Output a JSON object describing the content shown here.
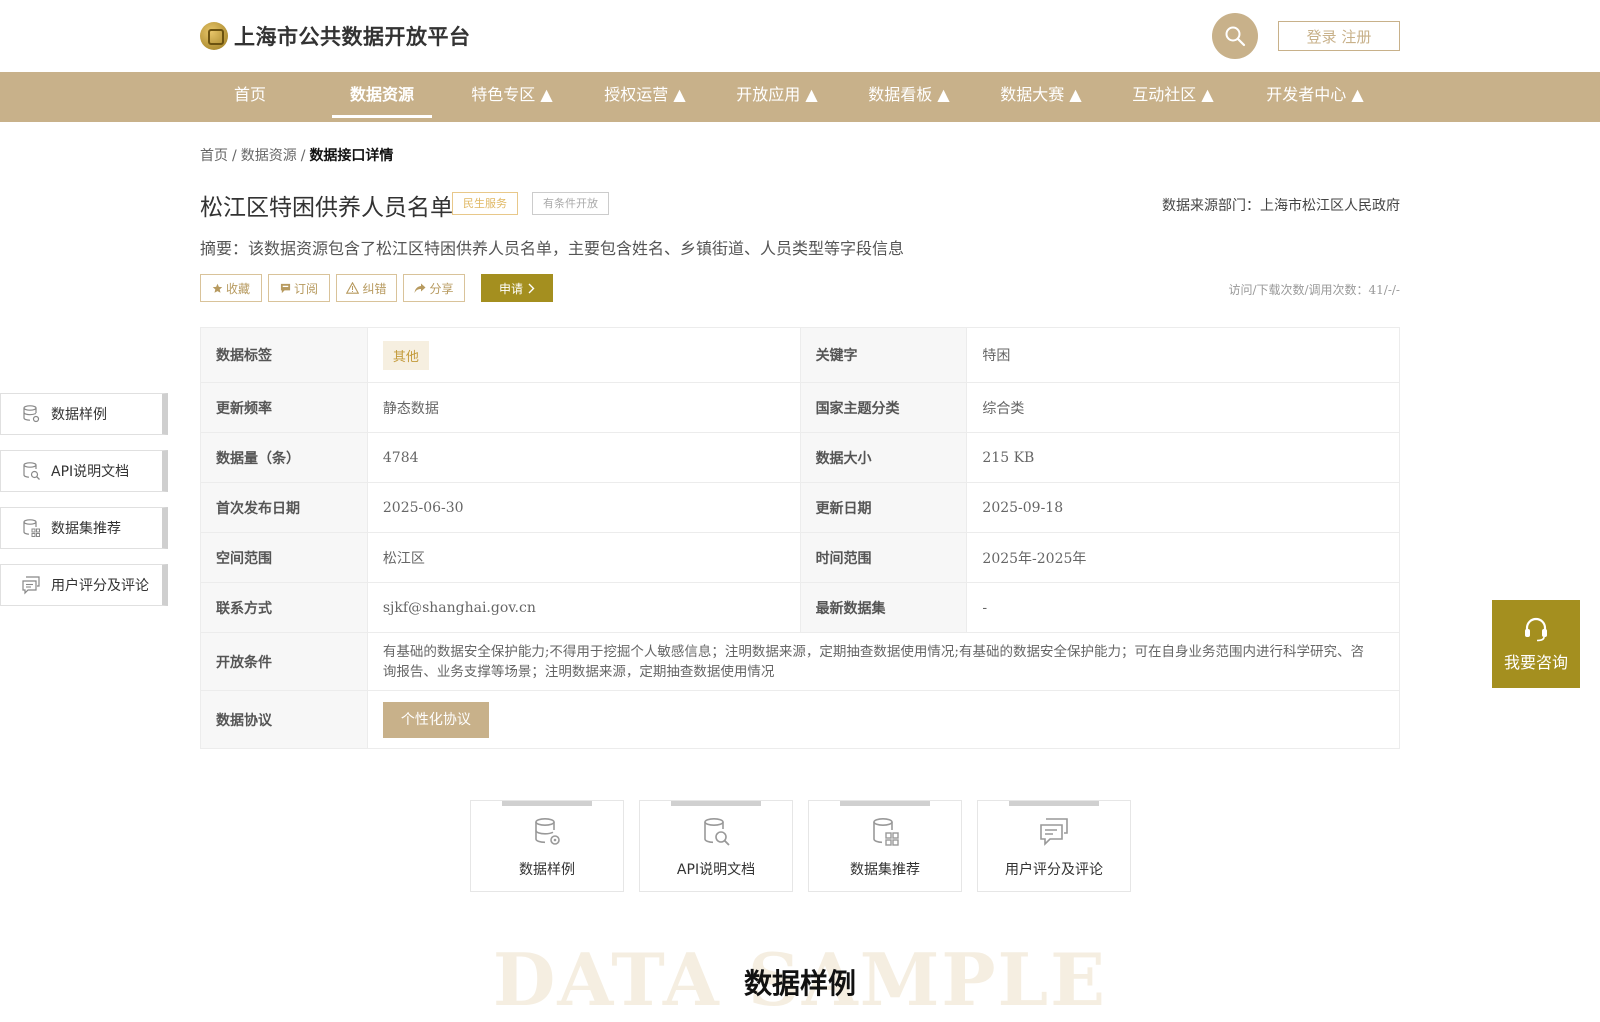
{
  "header": {
    "site_title": "上海市公共数据开放平台",
    "login_label": "登录 注册"
  },
  "nav": {
    "items": [
      {
        "label": "首页"
      },
      {
        "label": "数据资源",
        "active": true
      },
      {
        "label": "特色专区 ▲"
      },
      {
        "label": "授权运营 ▲"
      },
      {
        "label": "开放应用 ▲"
      },
      {
        "label": "数据看板 ▲"
      },
      {
        "label": "数据大赛 ▲"
      },
      {
        "label": "互动社区 ▲"
      },
      {
        "label": "开发者中心 ▲"
      }
    ]
  },
  "breadcrumb": {
    "home": "首页",
    "resources": "数据资源",
    "current": "数据接口详情",
    "sep": "/"
  },
  "dataset": {
    "title": "松江区特困供养人员名单",
    "tag_service": "民生服务",
    "tag_open": "有条件开放",
    "source": "数据来源部门：上海市松江区人民政府",
    "summary": "摘要：该数据资源包含了松江区特困供养人员名单，主要包含姓名、乡镇街道、人员类型等字段信息",
    "visits": "访问/下载次数/调用次数：41/-/-"
  },
  "actions": {
    "favorite": "收藏",
    "subscribe": "订阅",
    "report": "纠错",
    "share": "分享",
    "apply": "申请"
  },
  "table": {
    "k_tag": "数据标签",
    "v_tag": "其他",
    "k_keyword": "关键字",
    "v_keyword": "特困",
    "k_freq": "更新频率",
    "v_freq": "静态数据",
    "k_theme": "国家主题分类",
    "v_theme": "综合类",
    "k_count": "数据量（条）",
    "v_count": "4784",
    "k_size": "数据大小",
    "v_size": "215 KB",
    "k_first": "首次发布日期",
    "v_first": "2025-06-30",
    "k_updated": "更新日期",
    "v_updated": "2025-09-18",
    "k_space": "空间范围",
    "v_space": "松江区",
    "k_time": "时间范围",
    "v_time": "2025年-2025年",
    "k_contact": "联系方式",
    "v_contact": "sjkf@shanghai.gov.cn",
    "k_latest": "最新数据集",
    "v_latest": "-",
    "k_conditions": "开放条件",
    "v_conditions": "有基础的数据安全保护能力;不得用于挖掘个人敏感信息；注明数据来源，定期抽查数据使用情况;有基础的数据安全保护能力；可在自身业务范围内进行科学研究、咨询报告、业务支撑等场景；注明数据来源，定期抽查数据使用情况",
    "k_protocol": "数据协议",
    "v_protocol_btn": "个性化协议"
  },
  "side_menu": [
    {
      "label": "数据样例"
    },
    {
      "label": "API说明文档"
    },
    {
      "label": "数据集推荐"
    },
    {
      "label": "用户评分及评论"
    }
  ],
  "consult": {
    "label": "我要咨询"
  },
  "cards": [
    {
      "label": "数据样例"
    },
    {
      "label": "API说明文档"
    },
    {
      "label": "数据集推荐"
    },
    {
      "label": "用户评分及评论"
    }
  ],
  "section": {
    "bg_text": "DATA SAMPLE",
    "title": "数据样例"
  },
  "colors": {
    "brand": "#c8b18a",
    "apply": "#a48f1f"
  }
}
